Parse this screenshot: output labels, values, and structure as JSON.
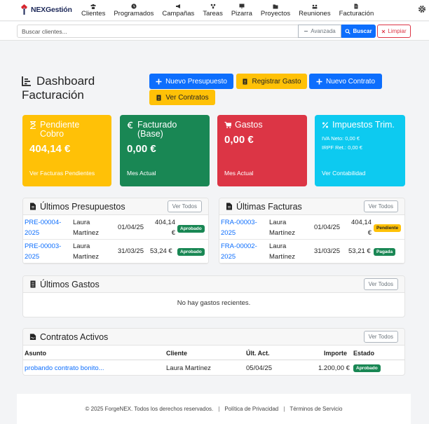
{
  "brand": {
    "name": "NEXGestión"
  },
  "nav": [
    {
      "label": "Clientes",
      "icon": "users-icon"
    },
    {
      "label": "Programados",
      "icon": "clock-icon"
    },
    {
      "label": "Campañas",
      "icon": "megaphone-icon"
    },
    {
      "label": "Tareas",
      "icon": "tasks-icon"
    },
    {
      "label": "Pizarra",
      "icon": "board-icon"
    },
    {
      "label": "Proyectos",
      "icon": "folder-icon"
    },
    {
      "label": "Reuniones",
      "icon": "meeting-icon"
    },
    {
      "label": "Facturación",
      "icon": "invoice-icon"
    }
  ],
  "search": {
    "placeholder": "Buscar clientes...",
    "advanced": "Avanzada",
    "search": "Buscar",
    "clear": "Limpiar"
  },
  "page": {
    "title_line1": "Dashboard",
    "title_line2": "Facturación"
  },
  "actions": {
    "new_quote": "Nuevo Presupuesto",
    "register_expense": "Registrar Gasto",
    "new_contract": "Nuevo Contrato",
    "view_contracts": "Ver Contratos"
  },
  "cards": {
    "pending": {
      "title": "Pendiente Cobro",
      "value": "404,14 €",
      "footer": "Ver Facturas Pendientes",
      "color": "#ffc107"
    },
    "billed": {
      "title": "Facturado (Base)",
      "value": "0,00 €",
      "footer": "Mes Actual",
      "color": "#198754"
    },
    "expenses": {
      "title": "Gastos",
      "value": "0,00 €",
      "footer": "Mes Actual",
      "color": "#dc3545"
    },
    "taxes": {
      "title": "Impuestos Trim.",
      "iva": "IVA Neto: 0,00 €",
      "irpf": "IRPF Ret.: 0,00 €",
      "footer": "Ver Contabilidad",
      "color": "#0dcaf0"
    }
  },
  "quotes": {
    "title": "Últimos Presupuestos",
    "view_all": "Ver Todos",
    "rows": [
      {
        "code": "PRE-00004-2025",
        "client": "Laura Martínez",
        "date": "01/04/25",
        "amount": "404,14 €",
        "status": "Aprobado"
      },
      {
        "code": "PRE-00003-2025",
        "client": "Laura Martínez",
        "date": "31/03/25",
        "amount": "53,24 €",
        "status": "Aprobado"
      }
    ]
  },
  "invoices": {
    "title": "Últimas Facturas",
    "view_all": "Ver Todos",
    "rows": [
      {
        "code": "FRA-00003-2025",
        "client": "Laura Martínez",
        "date": "01/04/25",
        "amount": "404,14 €",
        "status": "Pendiente"
      },
      {
        "code": "FRA-00002-2025",
        "client": "Laura Martínez",
        "date": "31/03/25",
        "amount": "53,21 €",
        "status": "Pagada"
      }
    ]
  },
  "expenses": {
    "title": "Últimos Gastos",
    "view_all": "Ver Todos",
    "empty": "No hay gastos recientes."
  },
  "contracts": {
    "title": "Contratos Activos",
    "view_all": "Ver Todos",
    "headers": {
      "subject": "Asunto",
      "client": "Cliente",
      "last_act": "Últ. Act.",
      "amount": "Importe",
      "status": "Estado"
    },
    "rows": [
      {
        "subject": "probando contrato bonito...",
        "client": "Laura Martínez",
        "last_act": "05/04/25",
        "amount": "1.200,00 €",
        "status": "Aprobado"
      }
    ]
  },
  "footer": {
    "copyright": "© 2025 ForgeNEX. Todos los derechos reservados.",
    "privacy": "Política de Privacidad",
    "terms": "Términos de Servicio",
    "separator": "|"
  }
}
